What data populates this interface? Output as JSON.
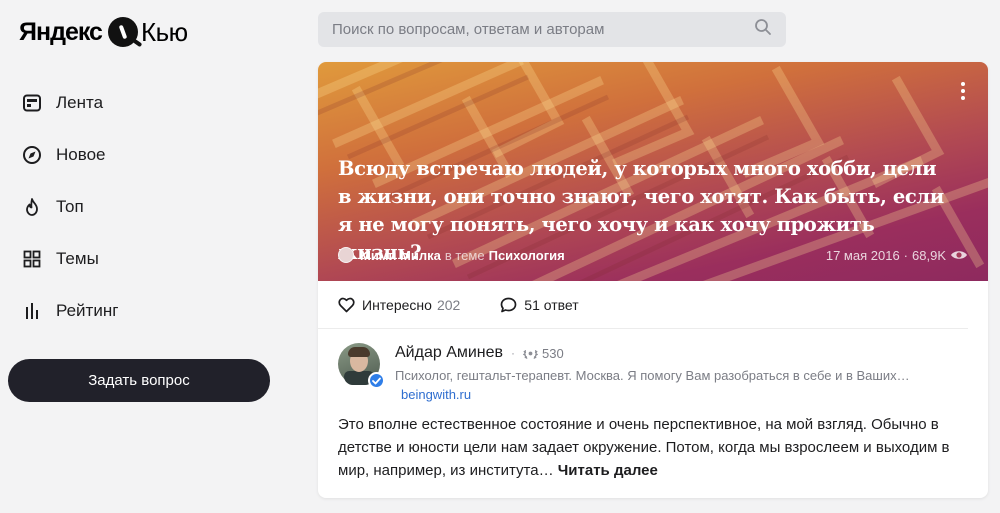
{
  "logo": {
    "brand": "Яндекс",
    "product": "Кью"
  },
  "nav": {
    "items": [
      {
        "label": "Лента",
        "icon": "feed-icon"
      },
      {
        "label": "Новое",
        "icon": "compass-icon"
      },
      {
        "label": "Топ",
        "icon": "fire-icon"
      },
      {
        "label": "Темы",
        "icon": "grid-icon"
      },
      {
        "label": "Рейтинг",
        "icon": "rating-bars-icon"
      }
    ],
    "ask_button": "Задать вопрос"
  },
  "search": {
    "placeholder": "Поиск по вопросам, ответам и авторам",
    "value": ""
  },
  "question": {
    "title": "Всюду встречаю людей, у которых много хобби, цели в жизни, они точно знают, чего хотят. Как быть, если я не могу понять, чего хочу и как хочу прожить жизнь?",
    "author": "Мими Милка",
    "in_topic_label": "в теме",
    "topic": "Психология",
    "date": "17 мая 2016",
    "separator": "·",
    "views": "68,9K"
  },
  "actions": {
    "interesting_label": "Интересно",
    "interesting_count": "202",
    "answers_label": "51 ответ"
  },
  "answer": {
    "author": "Айдар Аминев",
    "separator": "·",
    "rating": "530",
    "bio": "Психолог, гештальт-терапевт. Москва. Я помогу Вам разобраться в себе и в Ваших…",
    "link": "beingwith.ru",
    "text": "Это вполне естественное состояние и очень перспективное, на мой взгляд. Обычно в детстве и юности цели нам задает окружение. Потом, когда мы взрослеем и выходим в мир, например, из института…",
    "read_more": "Читать далее"
  },
  "colors": {
    "background": "#f3f3f4",
    "button_dark": "#21212a",
    "link_blue": "#2f6ecf",
    "verified_blue": "#2f7ee8",
    "banner_orange": "#e09a3c",
    "banner_purple": "#8e2a5e"
  }
}
